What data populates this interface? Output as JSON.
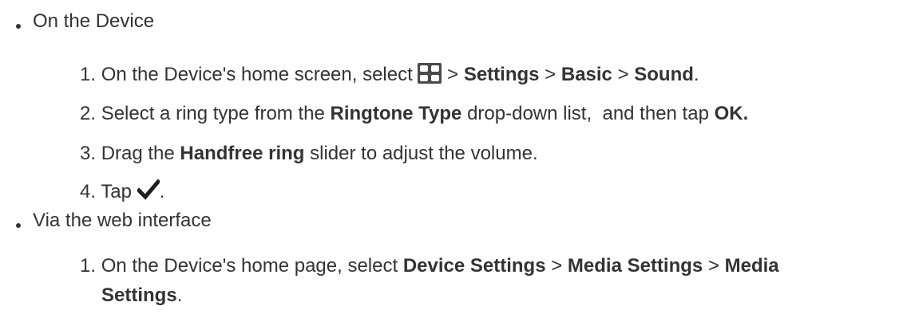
{
  "sections": [
    {
      "heading": "On the Device",
      "steps": [
        {
          "num": "1.",
          "pre": "On the Device's home screen, select",
          "icon": "apps-grid-icon",
          "sep1": ">",
          "b1": "Settings",
          "sep2": ">",
          "b2": "Basic",
          "sep3": ">",
          "b3": "Sound",
          "end": "."
        },
        {
          "num": "2.",
          "pre": "Select a ring type from the",
          "b1": "Ringtone Type",
          "mid": "drop-down list,  and then tap",
          "b2": "OK."
        },
        {
          "num": "3.",
          "pre": "Drag the",
          "b1": "Handfree ring",
          "post": "slider to adjust the volume."
        },
        {
          "num": "4.",
          "pre": "Tap",
          "icon": "checkmark-icon",
          "end": "."
        }
      ]
    },
    {
      "heading": "Via the web interface",
      "steps": [
        {
          "num": "1.",
          "pre": "On the Device's home page, select",
          "b1": "Device Settings",
          "sep1": ">",
          "b2": "Media Settings",
          "sep2": ">",
          "b3": "Media",
          "b3_cont": "Settings",
          "end": "."
        }
      ]
    }
  ]
}
